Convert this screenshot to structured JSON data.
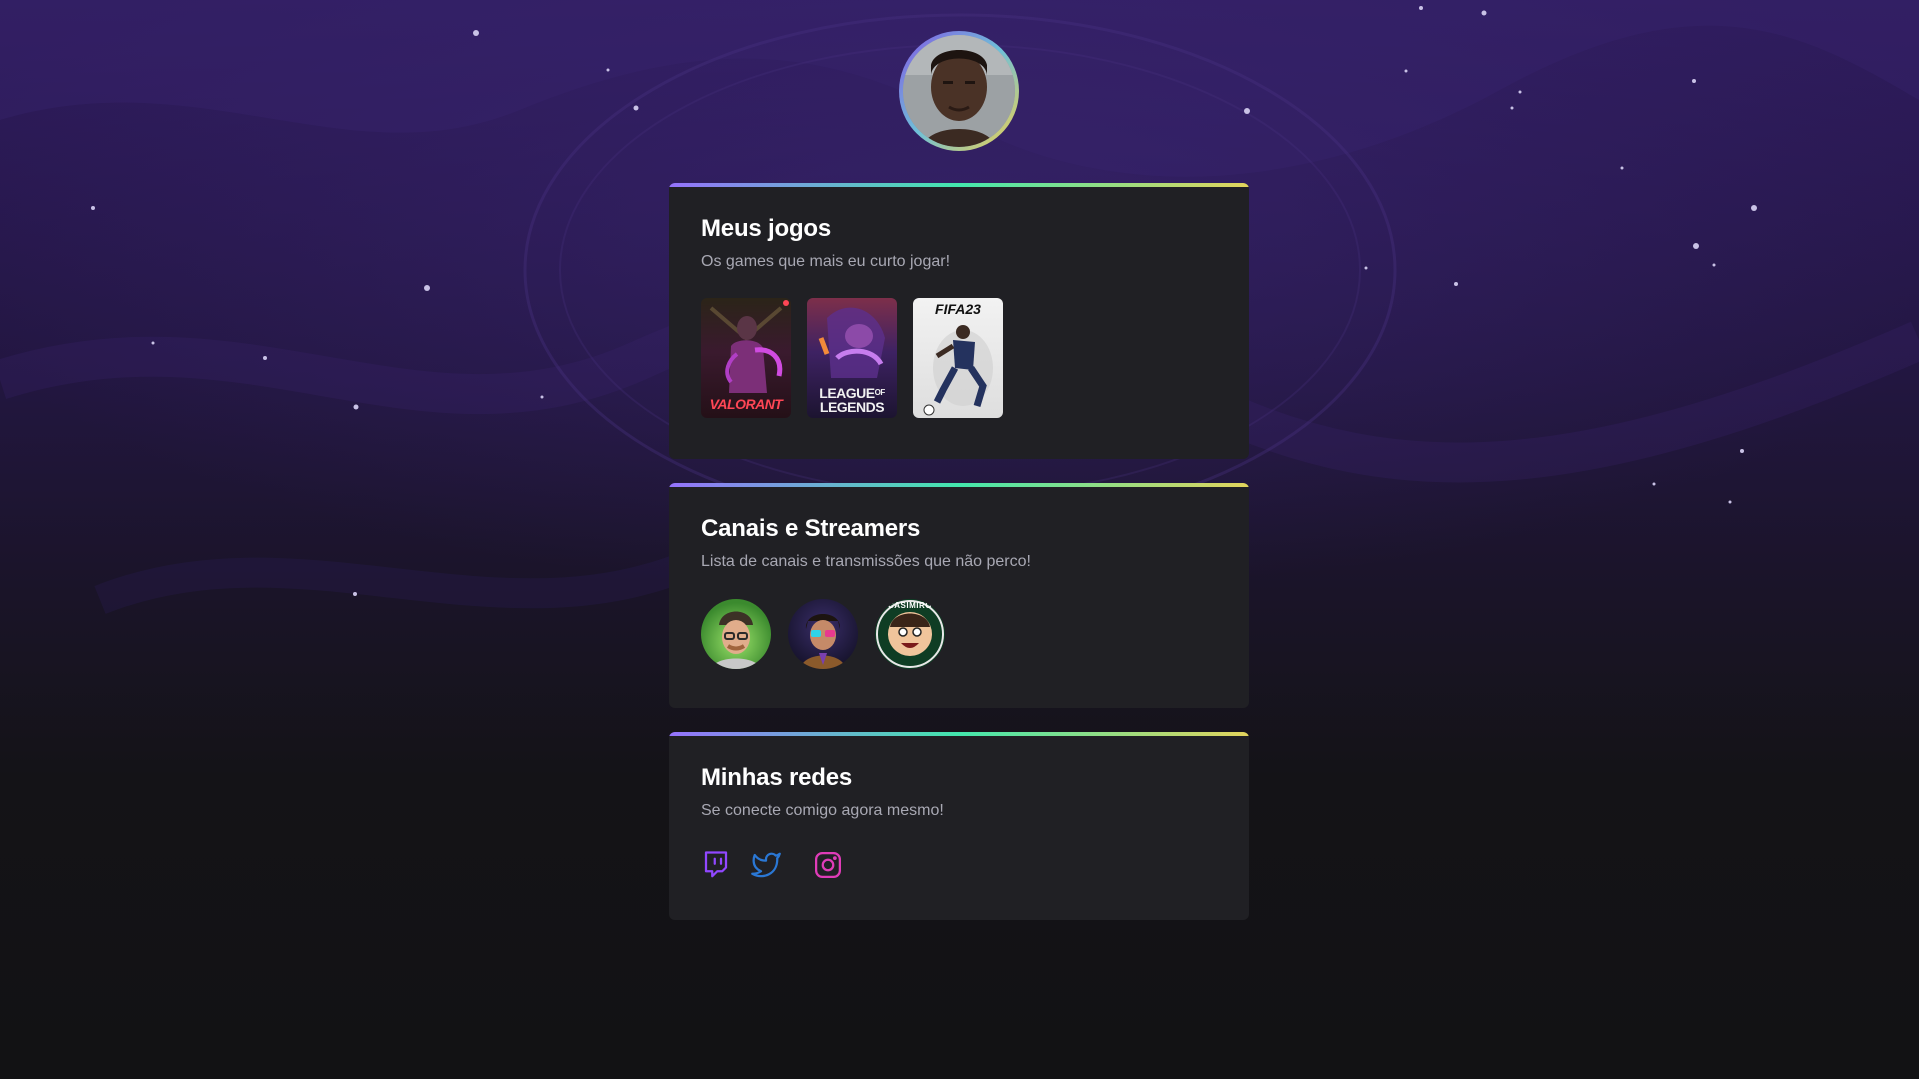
{
  "profile": {
    "avatar_alt": "profile-photo"
  },
  "sections": {
    "games": {
      "title": "Meus jogos",
      "subtitle": "Os games que mais eu curto jogar!",
      "items": [
        {
          "name": "VALORANT",
          "label": "VALORANT"
        },
        {
          "name": "League of Legends",
          "label_top": "LEAGUE",
          "label_of": "OF",
          "label_bottom": "LEGENDS"
        },
        {
          "name": "FIFA 23",
          "label": "FIFA23"
        }
      ]
    },
    "streamers": {
      "title": "Canais e Streamers",
      "subtitle": "Lista de canais e transmissões que não perco!",
      "items": [
        {
          "name": "streamer-1"
        },
        {
          "name": "streamer-2"
        },
        {
          "name": "Casimiro",
          "ring_text": "CASIMIRO"
        }
      ]
    },
    "socials": {
      "title": "Minhas redes",
      "subtitle": "Se conecte comigo agora mesmo!",
      "items": [
        {
          "name": "twitch",
          "icon": "twitch-icon",
          "color": "#9147ff"
        },
        {
          "name": "twitter",
          "icon": "twitter-icon",
          "color": "#2a77d4"
        },
        {
          "name": "instagram",
          "icon": "instagram-icon",
          "color": "#e03cb8"
        }
      ]
    }
  },
  "colors": {
    "accent_start": "#9572fc",
    "accent_mid": "#43e7ad",
    "accent_end": "#e2d45c",
    "card_bg": "#202024",
    "page_bg": "#121214"
  }
}
